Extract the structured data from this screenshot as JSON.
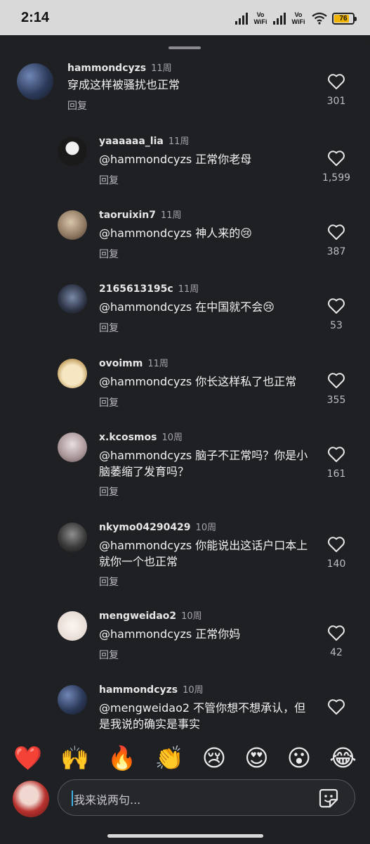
{
  "status_bar": {
    "time": "2:14",
    "vowifi_1": "Vo WiFi",
    "vowifi_2": "Vo WiFi",
    "battery": "76",
    "battery_color": "#f0b400"
  },
  "reply_label": "回复",
  "comments": [
    {
      "user": "hammondcyzs",
      "time": "11周",
      "text": "穿成这样被骚扰也正常",
      "likes": "301"
    },
    {
      "user": "yaaaaaa_lia",
      "time": "11周",
      "text": "@hammondcyzs 正常你老母",
      "likes": "1,599"
    },
    {
      "user": "taoruixin7",
      "time": "11周",
      "text": "@hammondcyzs 神人来的😢",
      "likes": "387"
    },
    {
      "user": "2165613195c",
      "time": "11周",
      "text": "@hammondcyzs 在中国就不会😢",
      "likes": "53"
    },
    {
      "user": "ovoimm",
      "time": "11周",
      "text": "@hammondcyzs 你长这样私了也正常",
      "likes": "355"
    },
    {
      "user": "x.kcosmos",
      "time": "10周",
      "text": "@hammondcyzs 脑子不正常吗？你是小脑萎缩了发育吗？",
      "likes": "161"
    },
    {
      "user": "nkymo04290429",
      "time": "10周",
      "text": "@hammondcyzs 你能说出这话户口本上就你一个也正常",
      "likes": "140"
    },
    {
      "user": "mengweidao2",
      "time": "10周",
      "text": "@hammondcyzs 正常你妈",
      "likes": "42"
    },
    {
      "user": "hammondcyzs",
      "time": "10周",
      "text": "@mengweidao2 不管你想不想承认，但是我说的确实是事实",
      "likes": ""
    }
  ],
  "emoji_bar": [
    "❤️",
    "🙌",
    "🔥",
    "👏",
    "😢",
    "😍",
    "😮",
    "😂"
  ],
  "input": {
    "placeholder": "我来说两句..."
  },
  "icons": {
    "like": "heart-outline-icon",
    "sticker": "sticker-icon"
  }
}
